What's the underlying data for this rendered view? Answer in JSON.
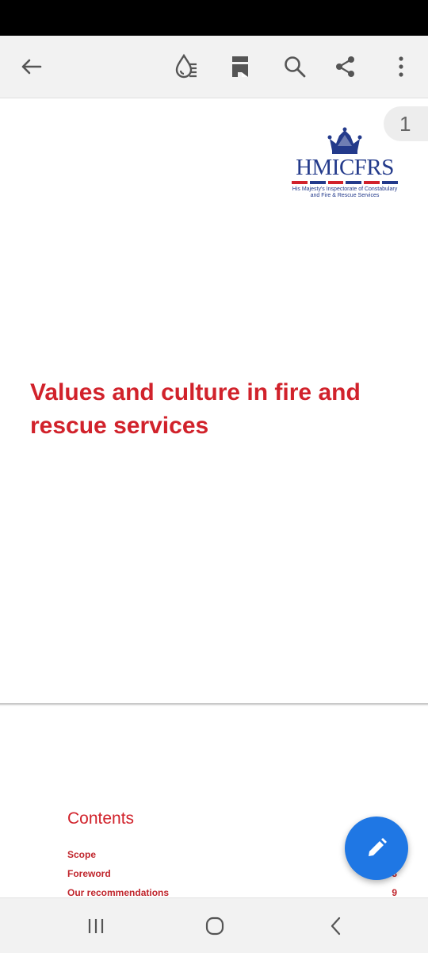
{
  "toolbar": {
    "icons": [
      "back-arrow-icon",
      "reading-mode-icon",
      "page-view-icon",
      "search-icon",
      "share-icon",
      "more-options-icon"
    ]
  },
  "document": {
    "page_number": "1",
    "logo": {
      "name": "HMICFRS",
      "subtitle_line1": "His Majesty's Inspectorate of Constabulary",
      "subtitle_line2": "and Fire & Rescue Services",
      "colors": {
        "primary": "#233a8b",
        "stripe_red": "#d1222b"
      }
    },
    "title": "Values and culture in fire and rescue services",
    "contents": {
      "heading": "Contents",
      "items": [
        {
          "label": "Scope",
          "page": ""
        },
        {
          "label": "Foreword",
          "page": "3"
        },
        {
          "label": "Our recommendations",
          "page": "9"
        }
      ]
    }
  },
  "fab": {
    "icon": "pencil-edit-icon",
    "color": "#1f77e4"
  },
  "navbar": {
    "icons": [
      "recent-apps-icon",
      "home-icon",
      "back-icon"
    ]
  },
  "colors": {
    "accent_red": "#d1222b",
    "background": "#f2f2f2"
  }
}
